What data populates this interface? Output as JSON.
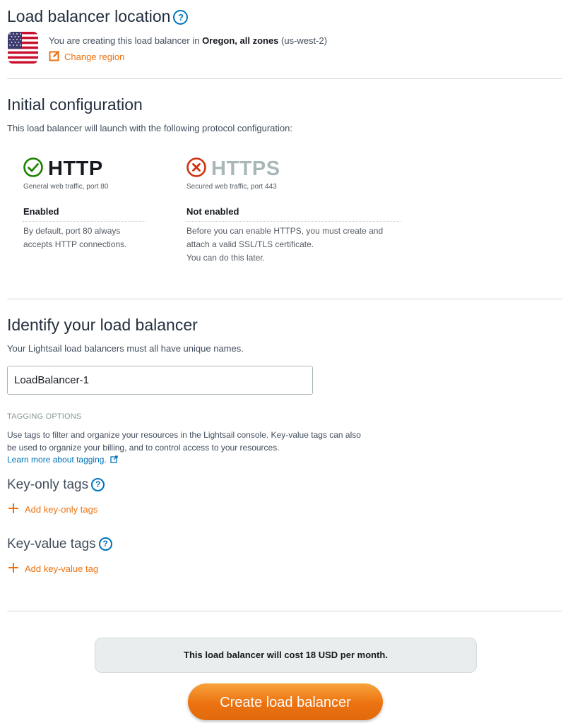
{
  "location": {
    "title": "Load balancer location",
    "help_icon": "?",
    "intro_text": "You are creating this load balancer in ",
    "region_bold": "Oregon, all zones",
    "region_code": " (us-west-2)",
    "change_region_label": "Change region"
  },
  "initial_config": {
    "title": "Initial configuration",
    "description": "This load balancer will launch with the following protocol configuration:",
    "protocols": [
      {
        "name": "HTTP",
        "subtitle": "General web traffic, port 80",
        "status": "Enabled",
        "notes": [
          "By default, port 80 always",
          "accepts HTTP connections."
        ],
        "status_icon": "check-circle-icon",
        "color": "#232f3e",
        "icon_color": "#1d8102"
      },
      {
        "name": "HTTPS",
        "subtitle": "Secured web traffic, port 443",
        "status": "Not enabled",
        "notes": [
          "Before you can enable HTTPS, you must create and",
          "attach a valid SSL/TLS certificate.",
          "You can do this later."
        ],
        "status_icon": "x-circle-icon",
        "color": "#aab7b8",
        "icon_color": "#d13212"
      }
    ]
  },
  "identify": {
    "title": "Identify your load balancer",
    "description": "Your Lightsail load balancers must all have unique names.",
    "name_value": "LoadBalancer-1"
  },
  "tagging": {
    "heading": "TAGGING OPTIONS",
    "description_line1": "Use tags to filter and organize your resources in the Lightsail console. Key-value tags can also",
    "description_line2": "be used to organize your billing, and to control access to your resources.",
    "learn_more_label": "Learn more about tagging.",
    "key_only_title": "Key-only tags",
    "add_key_only_label": "Add key-only tags",
    "key_value_title": "Key-value tags",
    "add_key_value_label": "Add key-value tag"
  },
  "footer": {
    "cost_text": "This load balancer will cost 18 USD per month.",
    "create_label": "Create load balancer"
  },
  "colors": {
    "accent_orange": "#ec7211",
    "link_blue": "#0073bb",
    "success_green": "#1d8102",
    "error_red": "#d13212"
  }
}
